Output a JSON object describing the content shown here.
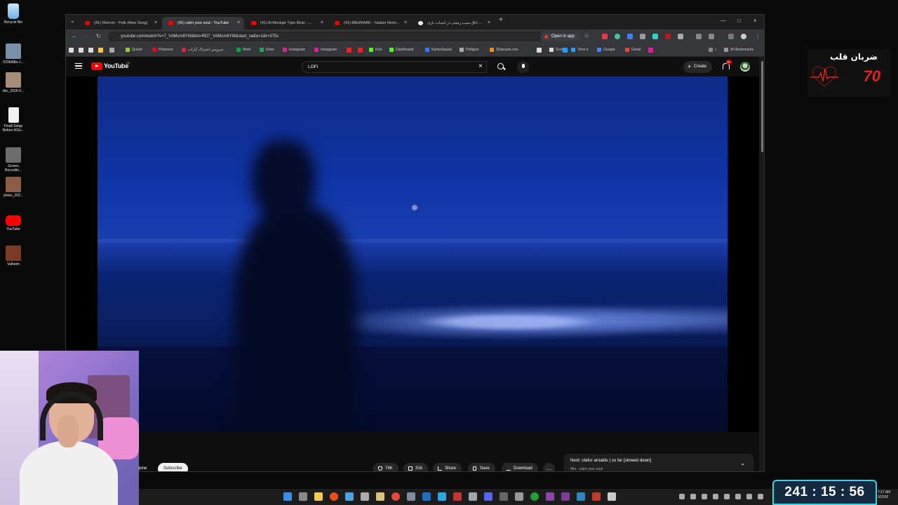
{
  "desktop": {
    "icons": [
      {
        "label": "Recycle Bin",
        "icon": "recycle-bin-icon",
        "color": "#6ab0e8"
      },
      {
        "label": "019fd08a-1...",
        "icon": "image-file-icon",
        "color": "#7a8fa8"
      },
      {
        "label": "doc_2026-0...",
        "icon": "image-file-icon",
        "color": "#a88e78"
      },
      {
        "label": "Finall Setup Before IKEv...",
        "icon": "document-icon",
        "color": "#f2f2f2"
      },
      {
        "label": "Screen Recordin...",
        "icon": "image-file-icon",
        "color": "#6d6d6d"
      },
      {
        "label": "photo_202...",
        "icon": "image-file-icon",
        "color": "#8a5d44"
      },
      {
        "label": "YouTube",
        "icon": "youtube-icon",
        "color": "#ff0000"
      },
      {
        "label": "Valheim",
        "icon": "valheim-icon",
        "color": "#7b3a24"
      }
    ]
  },
  "browser": {
    "tabs": [
      {
        "title": "(41) Shervin - Potk (New Song)",
        "favicon": "youtube-favicon"
      },
      {
        "title": "(41) calm your soul - YouTube",
        "favicon": "youtube-favicon",
        "active": true
      },
      {
        "title": "(41) Al Mosiqar Type Beat - ...",
        "favicon": "youtube-favicon"
      },
      {
        "title": "(41) MEHRAAK - Yadam Nemi...",
        "favicon": "youtube-favicon"
      },
      {
        "title": "اتاق سیب زمینی در اسباب بازی ...",
        "favicon": "google-favicon"
      }
    ],
    "url": "youtube.com/watch?v=7_VdMcm8YI8&list=RD7_VdMcm8YI8&start_radio=1&t=375s",
    "open_in_app": "Open in app",
    "bookmarks": [
      {
        "label": "Quixel",
        "color": "#9acd32"
      },
      {
        "label": "Pinterest",
        "color": "#e60023"
      },
      {
        "label": "سرویس اشتراک آپارات",
        "color": "#d7263d"
      },
      {
        "label": "Meet",
        "color": "#00ac47"
      },
      {
        "label": "Drive",
        "color": "#1fa463"
      },
      {
        "label": "Instagram",
        "color": "#d6249f"
      },
      {
        "label": "Instagram",
        "color": "#d6249f"
      },
      {
        "label": "Kick",
        "color": "#53fc18"
      },
      {
        "label": "Dashboard",
        "color": "#53fc18"
      },
      {
        "label": "KarboSquad",
        "color": "#2d7ff9"
      },
      {
        "label": "Polligon",
        "color": "#aaaaaa"
      },
      {
        "label": "3Dassets.one",
        "color": "#f28c28"
      },
      {
        "label": "Grok",
        "color": "#dddddd"
      },
      {
        "label": "Time.ir",
        "color": "#2a9df4"
      },
      {
        "label": "Google",
        "color": "#4285f4"
      },
      {
        "label": "Gmail",
        "color": "#ea4335"
      }
    ],
    "all_bookmarks": "All Bookmarks"
  },
  "youtube": {
    "logo_text": "YouTube",
    "country_code": "DE",
    "search_value": "LOFI",
    "create_label": "Create",
    "notifications_badge": "9+",
    "channel_name_partial": "gone",
    "subscribe_label": "Subscribe",
    "likes": "74K",
    "comments": "316",
    "share_label": "Share",
    "save_label": "Save",
    "download_label": "Download",
    "next_title": "Next: olafur arnalds | so far [slowed down]",
    "next_subtitle": "Mix - calm your soul"
  },
  "overlay": {
    "heart_rate_title": "ضربان قلب",
    "heart_rate_value": "70",
    "timer": "241 : 15 : 56",
    "tray_time": "7:27 AM",
    "tray_date": "3/2026"
  },
  "colors": {
    "youtube_red": "#ff0000",
    "heart_red": "#e02424",
    "timer_border": "#3ad3e6"
  }
}
